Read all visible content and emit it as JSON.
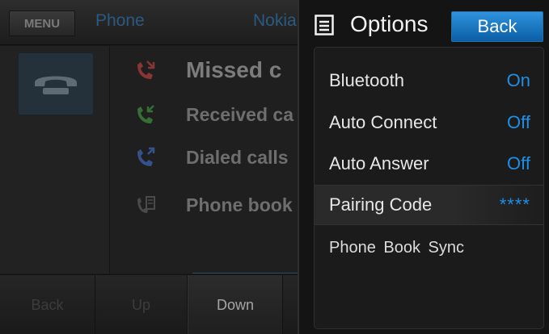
{
  "background": {
    "menu_label": "MENU",
    "app_title": "Phone",
    "device_name": "Nokia",
    "menu_items": [
      {
        "label": "Missed c",
        "icon": "missed-call-icon"
      },
      {
        "label": "Received ca",
        "icon": "received-call-icon"
      },
      {
        "label": "Dialed calls",
        "icon": "dialed-call-icon"
      },
      {
        "label": "Phone book",
        "icon": "phone-book-icon"
      }
    ],
    "bottom_buttons": {
      "back": "Back",
      "up": "Up",
      "down": "Down"
    }
  },
  "options": {
    "title": "Options",
    "back_label": "Back",
    "rows": [
      {
        "label": "Bluetooth",
        "value": "On"
      },
      {
        "label": "Auto Connect",
        "value": "Off"
      },
      {
        "label": "Auto Answer",
        "value": "Off"
      },
      {
        "label": "Pairing Code",
        "value": "****"
      },
      {
        "label": "Phone Book Sync",
        "value": ""
      }
    ]
  },
  "colors": {
    "accent": "#1f8fe6",
    "missed": "#9b3a3a",
    "received": "#3a7a3a",
    "dialed": "#3a5a9b"
  }
}
